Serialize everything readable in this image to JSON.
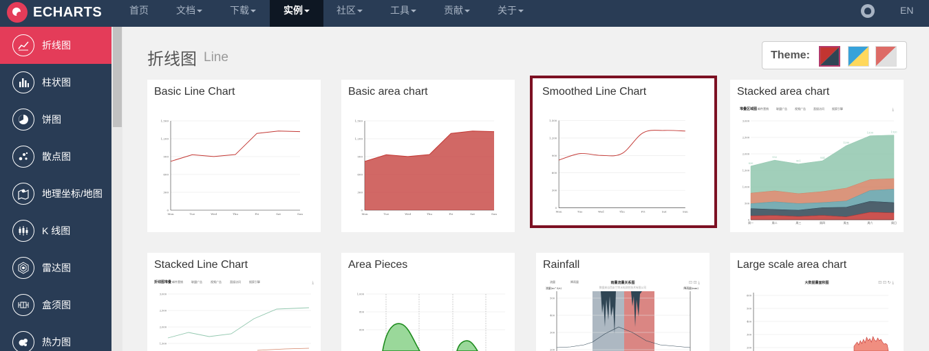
{
  "nav": {
    "logo_text": "ECHARTS",
    "items": [
      {
        "label": "首页",
        "caret": false
      },
      {
        "label": "文档",
        "caret": true
      },
      {
        "label": "下载",
        "caret": true
      },
      {
        "label": "实例",
        "caret": true,
        "active": true
      },
      {
        "label": "社区",
        "caret": true
      },
      {
        "label": "工具",
        "caret": true
      },
      {
        "label": "贡献",
        "caret": true
      },
      {
        "label": "关于",
        "caret": true
      }
    ],
    "github_icon": "github-icon",
    "lang": "EN"
  },
  "sidebar": {
    "items": [
      {
        "label": "折线图",
        "icon": "line-chart-icon",
        "active": true
      },
      {
        "label": "柱状图",
        "icon": "bar-chart-icon"
      },
      {
        "label": "饼图",
        "icon": "pie-chart-icon"
      },
      {
        "label": "散点图",
        "icon": "scatter-chart-icon"
      },
      {
        "label": "地理坐标/地图",
        "icon": "map-icon"
      },
      {
        "label": "K 线图",
        "icon": "candlestick-icon"
      },
      {
        "label": "雷达图",
        "icon": "radar-icon"
      },
      {
        "label": "盒须图",
        "icon": "boxplot-icon"
      },
      {
        "label": "热力图",
        "icon": "heatmap-icon"
      }
    ]
  },
  "main": {
    "title": "折线图",
    "subtitle": "Line",
    "theme": {
      "label": "Theme:",
      "swatches": [
        {
          "name": "default-theme",
          "colors": [
            "#c23531",
            "#2f4554"
          ],
          "selected": true
        },
        {
          "name": "light-theme",
          "colors": [
            "#37a2da",
            "#ffd85c"
          ]
        },
        {
          "name": "dark-theme",
          "colors": [
            "#dd6b66",
            "#e0e0e0"
          ]
        }
      ]
    },
    "cards": [
      {
        "title": "Basic Line Chart"
      },
      {
        "title": "Basic area chart"
      },
      {
        "title": "Smoothed Line Chart",
        "selected": true
      },
      {
        "title": "Stacked area chart"
      },
      {
        "title": "Stacked Line Chart"
      },
      {
        "title": "Area Pieces"
      },
      {
        "title": "Rainfall"
      },
      {
        "title": "Large scale area chart"
      }
    ]
  },
  "thumbs": {
    "week_days": [
      "Mon",
      "Tue",
      "Wed",
      "Thu",
      "Fri",
      "Sat",
      "Sun"
    ],
    "y_ticks": [
      "1,500",
      "1,200",
      "900",
      "600",
      "300",
      "0"
    ],
    "stacked_title": "堆叠区域图",
    "stacked_legend": [
      "邮件营销",
      "联盟广告",
      "视频广告",
      "直接访问",
      "搜索引擎"
    ],
    "stacked_days": [
      "周一",
      "周二",
      "周三",
      "周四",
      "周五",
      "周六",
      "周日"
    ],
    "stacked_y_ticks": [
      "3,000",
      "2,500",
      "2,000",
      "1,500",
      "1,000",
      "500",
      "0"
    ],
    "stacked_labels": [
      "820",
      "932",
      "901",
      "934",
      "1290",
      "1330",
      "1320"
    ],
    "stackedline_title": "折线图堆叠",
    "stackedline_y_ticks": [
      "3,000",
      "2,500",
      "2,000",
      "1,500"
    ],
    "pieces_y_ticks": [
      "1,000",
      "800",
      "600"
    ],
    "rain_title": "雨量流量关系图",
    "rain_subtitle": "数据来自西安兰特水电测控技术有限公司",
    "rain_legend": [
      "流量",
      "降雨量"
    ],
    "rain_left_axis": "流量(m^3/s)",
    "rain_right_axis": "降雨量(mm)",
    "rain_y_ticks": [
      "500",
      "400",
      "300",
      "200"
    ],
    "large_title": "大数据量面积图",
    "large_y_ticks": [
      "600",
      "500",
      "400",
      "300",
      "200"
    ]
  },
  "chart_data": [
    {
      "type": "line",
      "categories": [
        "Mon",
        "Tue",
        "Wed",
        "Thu",
        "Fri",
        "Sat",
        "Sun"
      ],
      "values": [
        820,
        932,
        901,
        934,
        1290,
        1330,
        1320
      ],
      "ylim": [
        0,
        1500
      ]
    },
    {
      "type": "area",
      "categories": [
        "Mon",
        "Tue",
        "Wed",
        "Thu",
        "Fri",
        "Sat",
        "Sun"
      ],
      "values": [
        820,
        932,
        901,
        934,
        1290,
        1330,
        1320
      ],
      "ylim": [
        0,
        1500
      ]
    },
    {
      "type": "line",
      "smooth": true,
      "categories": [
        "Mon",
        "Tue",
        "Wed",
        "Thu",
        "Fri",
        "Sat",
        "Sun"
      ],
      "values": [
        820,
        932,
        901,
        934,
        1290,
        1330,
        1320
      ],
      "ylim": [
        0,
        1500
      ]
    },
    {
      "type": "area",
      "stacked": true,
      "categories": [
        "周一",
        "周二",
        "周三",
        "周四",
        "周五",
        "周六",
        "周日"
      ],
      "series": [
        {
          "name": "邮件营销",
          "values": [
            120,
            132,
            101,
            134,
            90,
            230,
            210
          ]
        },
        {
          "name": "联盟广告",
          "values": [
            220,
            182,
            191,
            234,
            290,
            330,
            310
          ]
        },
        {
          "name": "视频广告",
          "values": [
            150,
            232,
            201,
            154,
            190,
            330,
            410
          ]
        },
        {
          "name": "直接访问",
          "values": [
            320,
            332,
            301,
            334,
            390,
            330,
            320
          ]
        },
        {
          "name": "搜索引擎",
          "values": [
            820,
            932,
            901,
            934,
            1290,
            1330,
            1320
          ]
        }
      ],
      "ylim": [
        0,
        3000
      ]
    }
  ]
}
